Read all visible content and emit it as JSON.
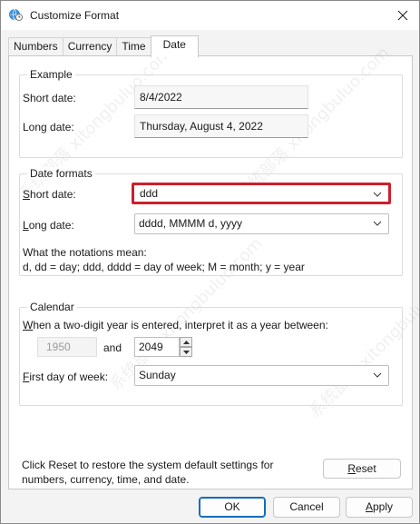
{
  "window": {
    "title": "Customize Format",
    "close_label": "×"
  },
  "tabs": [
    "Numbers",
    "Currency",
    "Time",
    "Date"
  ],
  "example": {
    "legend": "Example",
    "short_label": "Short date:",
    "short_value": "8/4/2022",
    "long_label": "Long date:",
    "long_value": "Thursday, August 4, 2022"
  },
  "formats": {
    "legend": "Date formats",
    "short_label_pre": "",
    "short_label_u": "S",
    "short_label_post": "hort date:",
    "short_value": "ddd",
    "long_label_u": "L",
    "long_label_post": "ong date:",
    "long_value": "dddd, MMMM d, yyyy",
    "notation_heading": "What the notations mean:",
    "notation_text": "d, dd = day;  ddd, dddd = day of week;  M = month;  y = year"
  },
  "calendar": {
    "legend": "Calendar",
    "two_digit_u": "W",
    "two_digit_post": "hen a two-digit year is entered, interpret it as a year between:",
    "year_from": "1950",
    "and_label": "and",
    "year_to": "2049",
    "first_day_u": "F",
    "first_day_post": "irst day of week:",
    "first_day_value": "Sunday"
  },
  "reset": {
    "text_line1": "Click Reset to restore the system default settings for",
    "text_line2": "numbers, currency, time, and date.",
    "button_u": "R",
    "button_post": "eset"
  },
  "footer": {
    "ok": "OK",
    "cancel": "Cancel",
    "apply_u": "A",
    "apply_post": "pply"
  },
  "watermark": "系统部落 xitongbuluo.com",
  "colors": {
    "highlight": "#cc1f2e",
    "accent": "#0f6cbd"
  }
}
